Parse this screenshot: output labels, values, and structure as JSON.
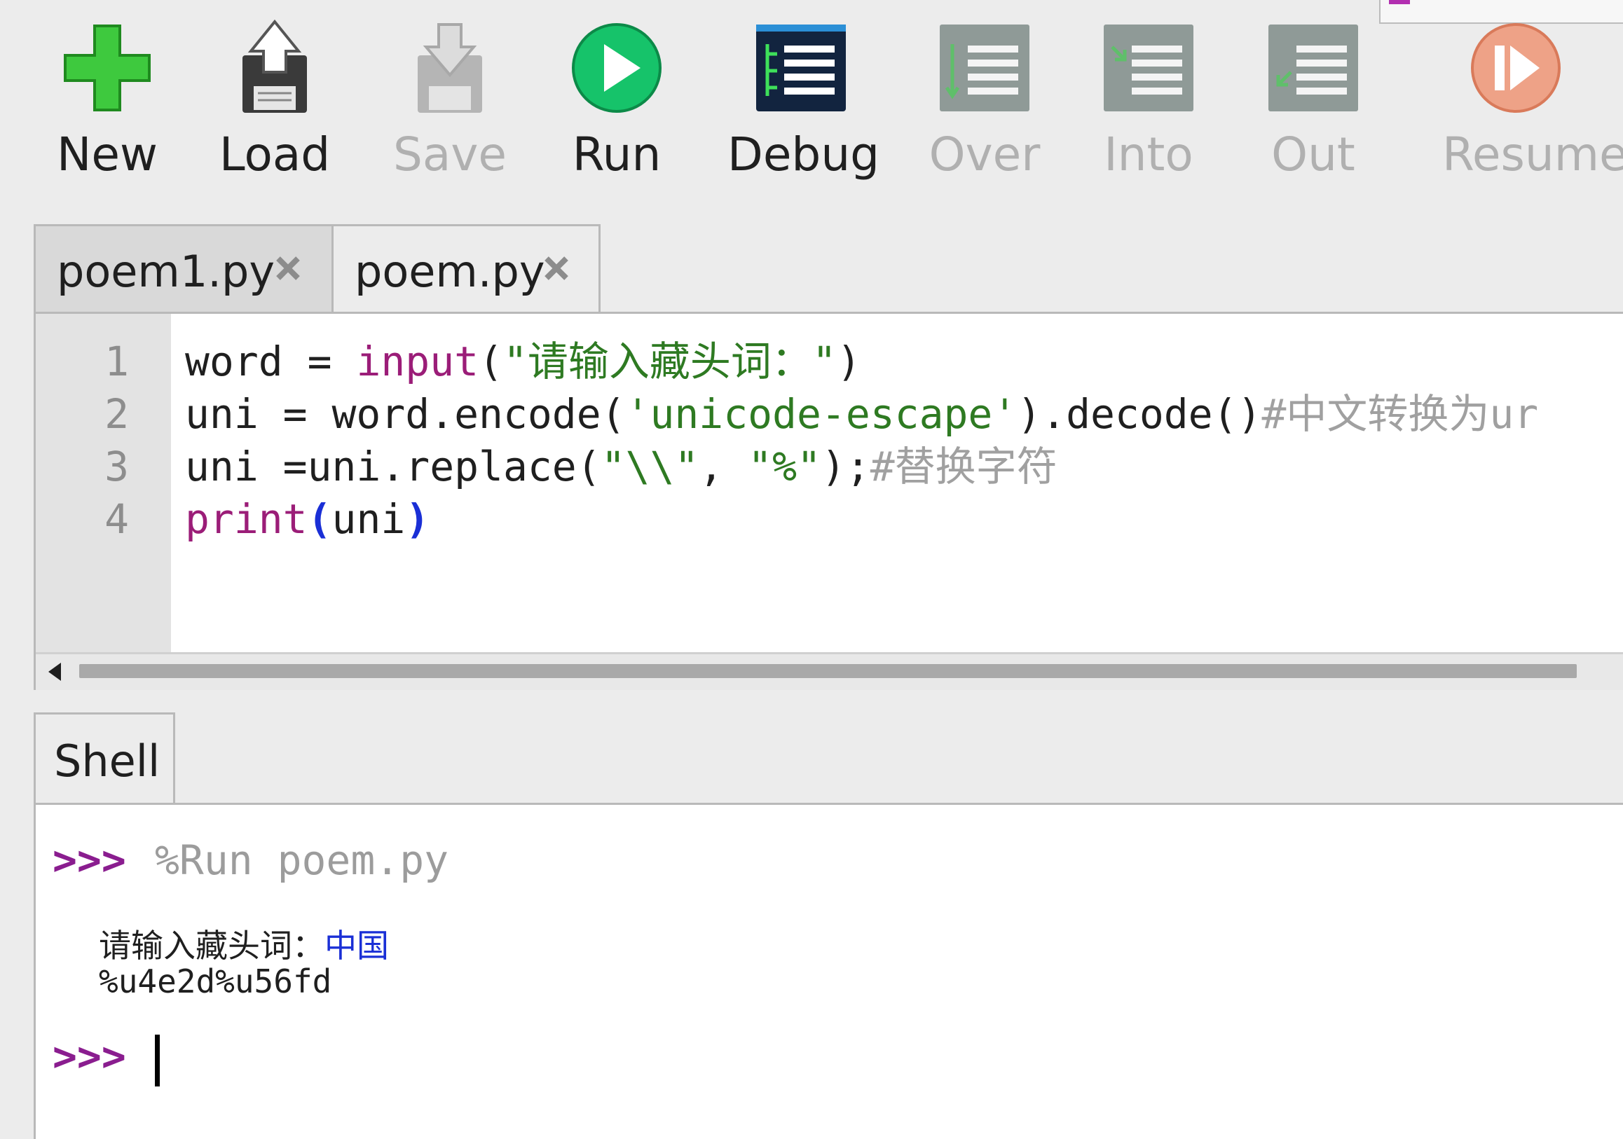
{
  "toolbar": {
    "buttons": [
      {
        "label": "New",
        "icon": "plus-icon",
        "enabled": true
      },
      {
        "label": "Load",
        "icon": "load-floppy-icon",
        "enabled": true
      },
      {
        "label": "Save",
        "icon": "save-floppy-icon",
        "enabled": false
      },
      {
        "label": "Run",
        "icon": "play-icon",
        "enabled": true
      },
      {
        "label": "Debug",
        "icon": "debug-icon",
        "enabled": true
      },
      {
        "label": "Over",
        "icon": "step-over-icon",
        "enabled": false
      },
      {
        "label": "Into",
        "icon": "step-into-icon",
        "enabled": false
      },
      {
        "label": "Out",
        "icon": "step-out-icon",
        "enabled": false
      },
      {
        "label": "Resume",
        "icon": "resume-icon",
        "enabled": false
      }
    ]
  },
  "editor": {
    "tabs": [
      {
        "label": "poem1.py",
        "active": false
      },
      {
        "label": "poem.py",
        "active": true
      }
    ],
    "line_numbers": [
      "1",
      "2",
      "3",
      "4"
    ],
    "lines": [
      {
        "tokens": [
          {
            "t": "word = "
          },
          {
            "t": "input",
            "c": "builtin"
          },
          {
            "t": "("
          },
          {
            "t": "\"请输入藏头词：\"",
            "c": "str"
          },
          {
            "t": ")"
          }
        ]
      },
      {
        "tokens": [
          {
            "t": "uni = word.encode("
          },
          {
            "t": "'unicode-escape'",
            "c": "str"
          },
          {
            "t": ").decode()"
          },
          {
            "t": "#中文转换为ur",
            "c": "comment"
          }
        ]
      },
      {
        "tokens": [
          {
            "t": "uni =uni.replace("
          },
          {
            "t": "\"\\\\\"",
            "c": "str"
          },
          {
            "t": ", "
          },
          {
            "t": "\"%\"",
            "c": "str"
          },
          {
            "t": ");"
          },
          {
            "t": "#替换字符",
            "c": "comment"
          }
        ]
      },
      {
        "tokens": [
          {
            "t": "print",
            "c": "builtin"
          },
          {
            "t": "(",
            "c": "bparen"
          },
          {
            "t": "uni"
          },
          {
            "t": ")",
            "c": "bparen"
          }
        ]
      }
    ]
  },
  "shell": {
    "tab_label": "Shell",
    "prompt": ">>>",
    "run_command": "%Run poem.py",
    "output_prompt": "请输入藏头词：",
    "output_input": "中国",
    "output_result": "%u4e2d%u56fd"
  },
  "colors": {
    "builtin": "#9b1d78",
    "string": "#2e7a22",
    "comment": "#a0a0a0",
    "prompt": "#8a1d8f",
    "user_input": "#1a2fd6"
  }
}
